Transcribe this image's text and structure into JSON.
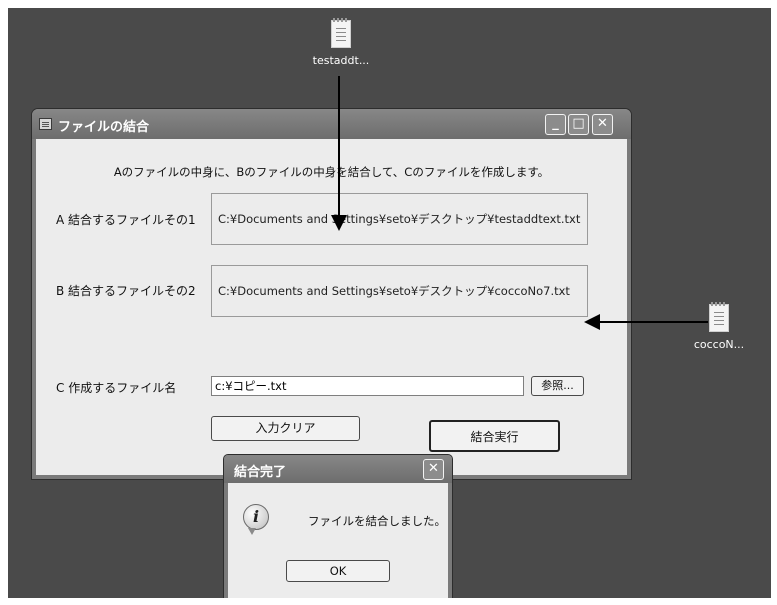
{
  "desktop": {
    "icons": [
      {
        "label": "testaddt..."
      },
      {
        "label": "coccoN..."
      }
    ]
  },
  "window": {
    "title": "ファイルの結合",
    "minimize": "_",
    "maximize": "□",
    "close": "✕",
    "description": "Aのファイルの中身に、Bのファイルの中身を結合して、Cのファイルを作成します。",
    "row_a_label": "A 結合するファイルその1",
    "row_a_value": "C:¥Documents and Settings¥seto¥デスクトップ¥testaddtext.txt",
    "row_b_label": "B 結合するファイルその2",
    "row_b_value": "C:¥Documents and Settings¥seto¥デスクトップ¥coccoNo7.txt",
    "row_c_label": "C 作成するファイル名",
    "row_c_value": "c:¥コピー.txt",
    "browse_label": "参照...",
    "clear_label": "入力クリア",
    "merge_label": "結合実行"
  },
  "dialog": {
    "title": "結合完了",
    "close": "✕",
    "message": "ファイルを結合しました。",
    "ok_label": "OK"
  }
}
